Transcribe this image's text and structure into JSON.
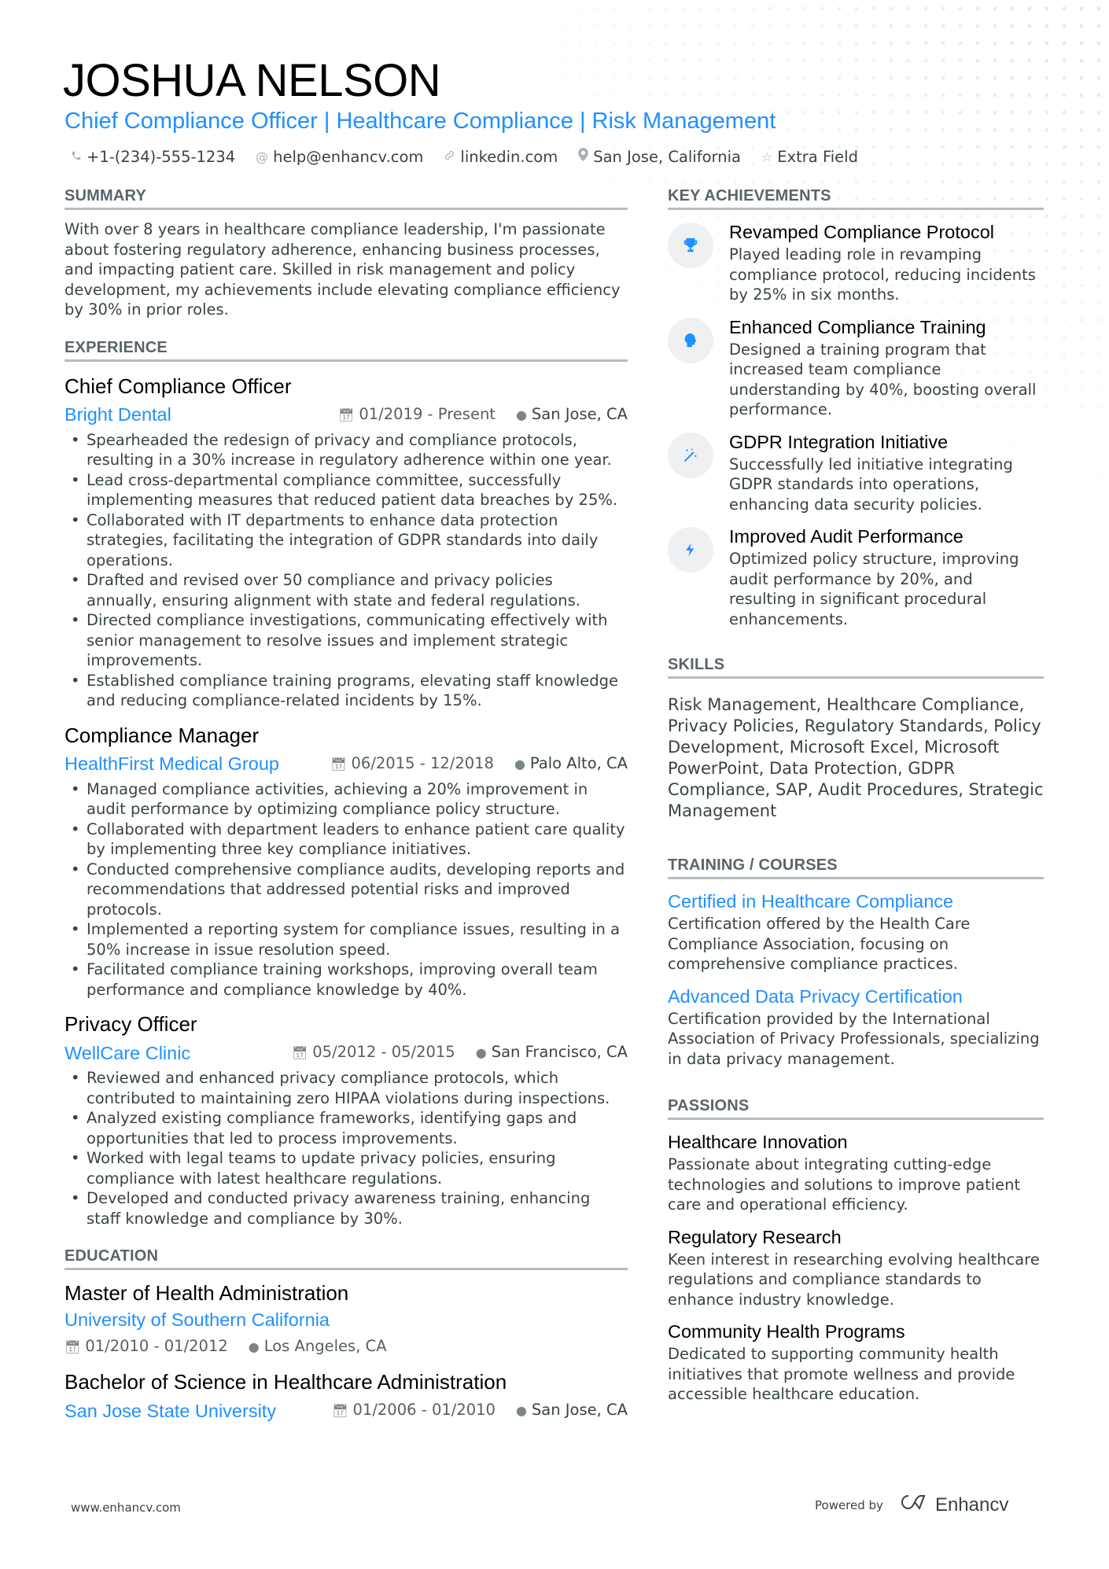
{
  "header": {
    "name": "JOSHUA NELSON",
    "headline": "Chief Compliance Officer | Healthcare Compliance | Risk Management",
    "contacts": [
      {
        "icon": "phone-icon",
        "text": "+1-(234)-555-1234"
      },
      {
        "icon": "at-icon",
        "text": "help@enhancv.com"
      },
      {
        "icon": "link-icon",
        "text": "linkedin.com"
      },
      {
        "icon": "location-icon",
        "text": "San Jose, California"
      },
      {
        "icon": "star-icon",
        "text": "Extra Field"
      }
    ]
  },
  "summary": {
    "title": "SUMMARY",
    "text": "With over 8 years in healthcare compliance leadership, I'm passionate about fostering regulatory adherence, enhancing business processes, and impacting patient care. Skilled in risk management and policy development, my achievements include elevating compliance efficiency by 30% in prior roles."
  },
  "experience": {
    "title": "EXPERIENCE",
    "items": [
      {
        "role": "Chief Compliance Officer",
        "company": "Bright Dental",
        "dates": "01/2019 - Present",
        "location": "San Jose, CA",
        "bullets": [
          "Spearheaded the redesign of privacy and compliance protocols, resulting in a 30% increase in regulatory adherence within one year.",
          "Lead cross-departmental compliance committee, successfully implementing measures that reduced patient data breaches by 25%.",
          "Collaborated with IT departments to enhance data protection strategies, facilitating the integration of GDPR standards into daily operations.",
          "Drafted and revised over 50 compliance and privacy policies annually, ensuring alignment with state and federal regulations.",
          "Directed compliance investigations, communicating effectively with senior management to resolve issues and implement strategic improvements.",
          "Established compliance training programs, elevating staff knowledge and reducing compliance-related incidents by 15%."
        ]
      },
      {
        "role": "Compliance Manager",
        "company": "HealthFirst Medical Group",
        "dates": "06/2015 - 12/2018",
        "location": "Palo Alto, CA",
        "bullets": [
          "Managed compliance activities, achieving a 20% improvement in audit performance by optimizing compliance policy structure.",
          "Collaborated with department leaders to enhance patient care quality by implementing three key compliance initiatives.",
          "Conducted comprehensive compliance audits, developing reports and recommendations that addressed potential risks and improved protocols.",
          "Implemented a reporting system for compliance issues, resulting in a 50% increase in issue resolution speed.",
          "Facilitated compliance training workshops, improving overall team performance and compliance knowledge by 40%."
        ]
      },
      {
        "role": "Privacy Officer",
        "company": "WellCare Clinic",
        "dates": "05/2012 - 05/2015",
        "location": "San Francisco, CA",
        "bullets": [
          "Reviewed and enhanced privacy compliance protocols, which contributed to maintaining zero HIPAA violations during inspections.",
          "Analyzed existing compliance frameworks, identifying gaps and opportunities that led to process improvements.",
          "Worked with legal teams to update privacy policies, ensuring compliance with latest healthcare regulations.",
          "Developed and conducted privacy awareness training, enhancing staff knowledge and compliance by 30%."
        ]
      }
    ]
  },
  "education": {
    "title": "EDUCATION",
    "items": [
      {
        "degree": "Master of Health Administration",
        "school": "University of Southern California",
        "dates": "01/2010 - 01/2012",
        "location": "Los Angeles, CA"
      },
      {
        "degree": "Bachelor of Science in Healthcare Administration",
        "school": "San Jose State University",
        "dates": "01/2006 - 01/2010",
        "location": "San Jose, CA"
      }
    ]
  },
  "achievements": {
    "title": "KEY ACHIEVEMENTS",
    "items": [
      {
        "icon": "trophy-icon",
        "title": "Revamped Compliance Protocol",
        "desc": "Played leading role in revamping compliance protocol, reducing incidents by 25% in six months."
      },
      {
        "icon": "brain-head-icon",
        "title": "Enhanced Compliance Training",
        "desc": "Designed a training program that increased team compliance understanding by 40%, boosting overall performance."
      },
      {
        "icon": "magic-wand-icon",
        "title": "GDPR Integration Initiative",
        "desc": "Successfully led initiative integrating GDPR standards into operations, enhancing data security policies."
      },
      {
        "icon": "lightning-bolt-icon",
        "title": "Improved Audit Performance",
        "desc": "Optimized policy structure, improving audit performance by 20%, and resulting in significant procedural enhancements."
      }
    ]
  },
  "skills": {
    "title": "SKILLS",
    "text": "Risk Management, Healthcare Compliance, Privacy Policies, Regulatory Standards, Policy Development, Microsoft Excel, Microsoft PowerPoint, Data Protection, GDPR Compliance, SAP, Audit Procedures, Strategic Management"
  },
  "training": {
    "title": "TRAINING / COURSES",
    "items": [
      {
        "title": "Certified in Healthcare Compliance",
        "desc": "Certification offered by the Health Care Compliance Association, focusing on comprehensive compliance practices."
      },
      {
        "title": "Advanced Data Privacy Certification",
        "desc": "Certification provided by the International Association of Privacy Professionals, specializing in data privacy management."
      }
    ]
  },
  "passions": {
    "title": "PASSIONS",
    "items": [
      {
        "title": "Healthcare Innovation",
        "desc": "Passionate about integrating cutting-edge technologies and solutions to improve patient care and operational efficiency."
      },
      {
        "title": "Regulatory Research",
        "desc": "Keen interest in researching evolving healthcare regulations and compliance standards to enhance industry knowledge."
      },
      {
        "title": "Community Health Programs",
        "desc": "Dedicated to supporting community health initiatives that promote wellness and provide accessible healthcare education."
      }
    ]
  },
  "footer": {
    "website": "www.enhancv.com",
    "powered_by": "Powered by",
    "brand": "Enhancv"
  },
  "colors": {
    "accent": "#1e90ff",
    "text": "#384347",
    "heading": "#000000",
    "rule": "#b7bcbf",
    "icon_bg": "#eef0f2"
  }
}
